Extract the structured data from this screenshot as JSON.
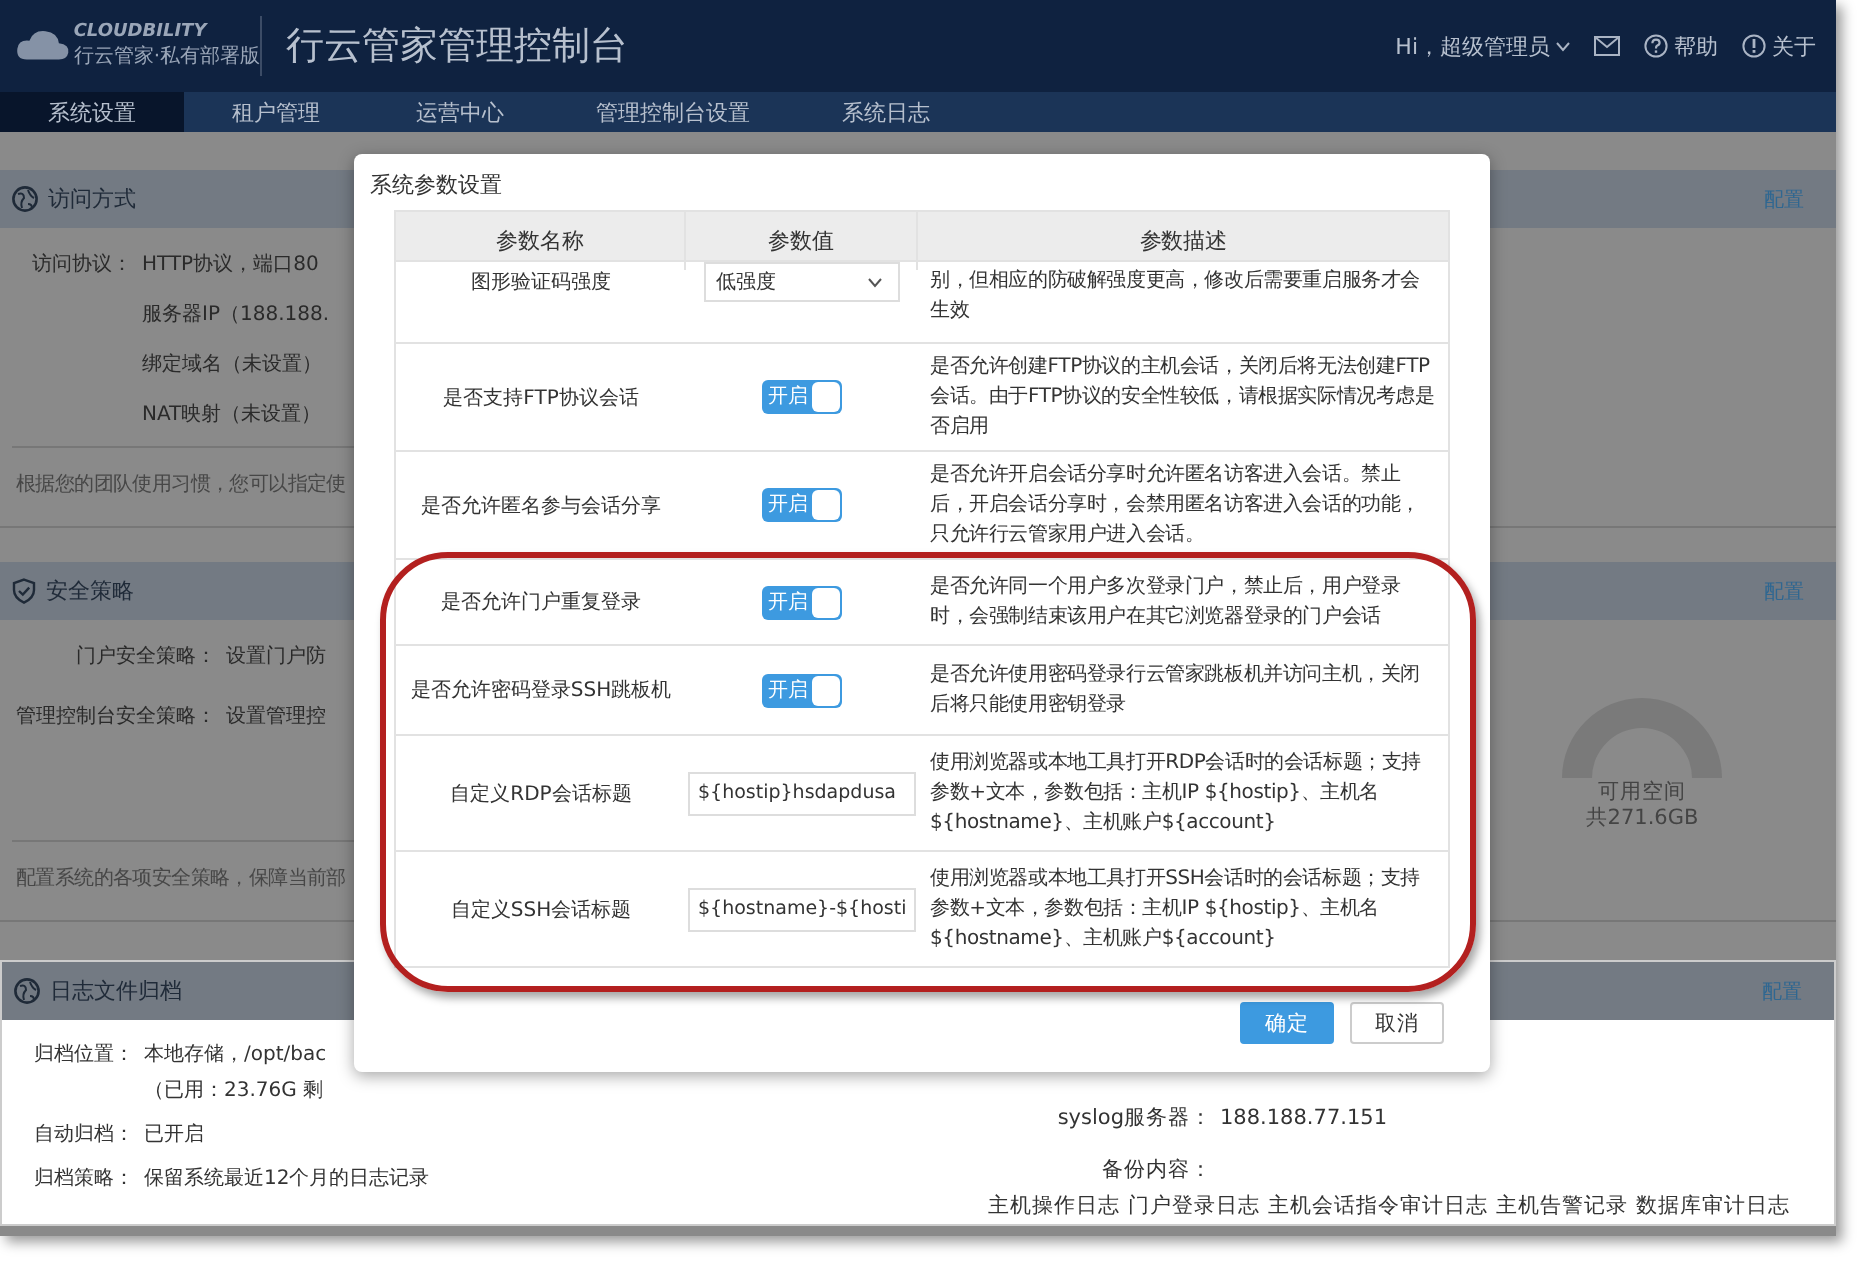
{
  "header": {
    "logo_brand": "CLOUDBILITY",
    "logo_subtitle": "行云管家·私有部署版",
    "title": "行云管家管理控制台",
    "user_menu": "Hi，超级管理员",
    "help": "帮助",
    "about": "关于"
  },
  "nav": [
    {
      "label": "系统设置",
      "selected": true
    },
    {
      "label": "租户管理",
      "selected": false
    },
    {
      "label": "运营中心",
      "selected": false
    },
    {
      "label": "管理控制台设置",
      "selected": false
    },
    {
      "label": "系统日志",
      "selected": false
    }
  ],
  "sections": [
    {
      "title": "访问方式",
      "action": "配置",
      "fields": [
        {
          "label": "访问协议：",
          "values": [
            "HTTP协议，端口80",
            "服务器IP（188.188.",
            "绑定域名（未设置）",
            "NAT映射（未设置）"
          ]
        }
      ],
      "hint": "根据您的团队使用习惯，您可以指定使"
    },
    {
      "title": "安全策略",
      "action": "配置",
      "fields": [
        {
          "label": "门户安全策略：",
          "values": [
            "设置门户防"
          ]
        },
        {
          "label": "管理控制台安全策略：",
          "values": [
            "设置管理控"
          ]
        }
      ],
      "hint": "配置系统的各项安全策略，保障当前部",
      "aside": {
        "kind": "gauge",
        "label": "可用空间",
        "total": "共271.6GB"
      }
    },
    {
      "title": "日志文件归档",
      "action": "配置",
      "fields": [
        {
          "label": "归档位置：",
          "values": [
            "本地存储，/opt/bac",
            "（已用：23.76G 剩"
          ]
        },
        {
          "label": "自动归档：",
          "values": [
            "已开启"
          ]
        },
        {
          "label": "归档策略：",
          "values": [
            "保留系统最近12个月的日志记录"
          ]
        }
      ],
      "aside": {
        "kind": "syslog",
        "server_label": "syslog服务器：",
        "server": "188.188.77.151",
        "backup_label": "备份内容：",
        "backup_items": [
          "主机操作日志",
          "门户登录日志",
          "主机会话指令审计日志",
          "主机告警记录",
          "数据库审计日志"
        ]
      }
    }
  ],
  "dialog": {
    "title": "系统参数设置",
    "columns": [
      "参数名称",
      "参数值",
      "参数描述"
    ],
    "rows": [
      {
        "name": "图形验证码强度",
        "kind": "select",
        "value": "低强度",
        "description": "别，但相应的防破解强度更高，修改后需要重启服务才会生效"
      },
      {
        "name": "是否支持FTP协议会话",
        "kind": "toggle",
        "on": true,
        "value": "开启",
        "description": "是否允许创建FTP协议的主机会话，关闭后将无法创建FTP会话。由于FTP协议的安全性较低，请根据实际情况考虑是否启用"
      },
      {
        "name": "是否允许匿名参与会话分享",
        "kind": "toggle",
        "on": true,
        "value": "开启",
        "description": "是否允许开启会话分享时允许匿名访客进入会话。禁止后，开启会话分享时，会禁用匿名访客进入会话的功能，只允许行云管家用户进入会话。"
      },
      {
        "name": "是否允许门户重复登录",
        "kind": "toggle",
        "on": true,
        "value": "开启",
        "description": "是否允许同一个用户多次登录门户，禁止后，用户登录时，会强制结束该用户在其它浏览器登录的门户会话"
      },
      {
        "name": "是否允许密码登录SSH跳板机",
        "kind": "toggle",
        "on": true,
        "value": "开启",
        "description": "是否允许使用密码登录行云管家跳板机并访问主机，关闭后将只能使用密钥登录"
      },
      {
        "name": "自定义RDP会话标题",
        "kind": "input",
        "value": "${hostip}hsdapdusa",
        "description": "使用浏览器或本地工具打开RDP会话时的会话标题；支持参数+文本，参数包括：主机IP ${hostip}、主机名${hostname}、主机账户${account}"
      },
      {
        "name": "自定义SSH会话标题",
        "kind": "input",
        "value": "${hostname}-${hosti",
        "description": "使用浏览器或本地工具打开SSH会话时的会话标题；支持参数+文本，参数包括：主机IP ${hostip}、主机名${hostname}、主机账户${account}"
      }
    ],
    "buttons": [
      {
        "label": "确定",
        "kind": "primary"
      },
      {
        "label": "取消",
        "kind": "secondary"
      }
    ]
  }
}
